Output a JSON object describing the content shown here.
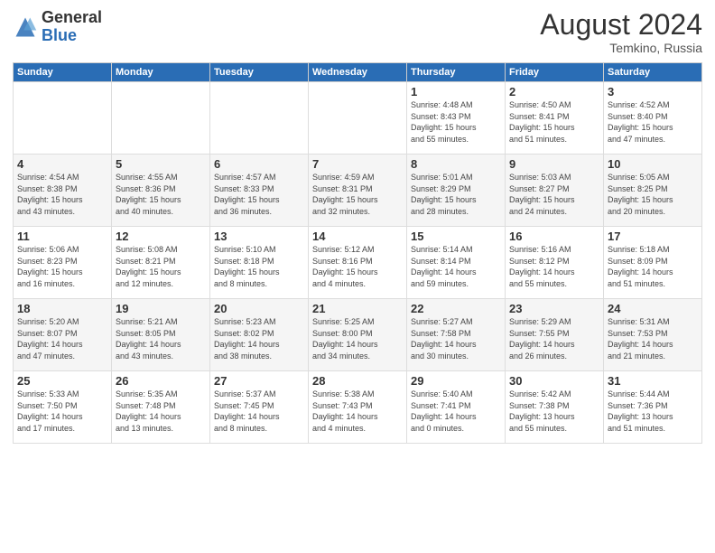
{
  "logo": {
    "general": "General",
    "blue": "Blue"
  },
  "title": {
    "month_year": "August 2024",
    "location": "Temkino, Russia"
  },
  "headers": [
    "Sunday",
    "Monday",
    "Tuesday",
    "Wednesday",
    "Thursday",
    "Friday",
    "Saturday"
  ],
  "weeks": [
    [
      {
        "day": "",
        "info": ""
      },
      {
        "day": "",
        "info": ""
      },
      {
        "day": "",
        "info": ""
      },
      {
        "day": "",
        "info": ""
      },
      {
        "day": "1",
        "info": "Sunrise: 4:48 AM\nSunset: 8:43 PM\nDaylight: 15 hours\nand 55 minutes."
      },
      {
        "day": "2",
        "info": "Sunrise: 4:50 AM\nSunset: 8:41 PM\nDaylight: 15 hours\nand 51 minutes."
      },
      {
        "day": "3",
        "info": "Sunrise: 4:52 AM\nSunset: 8:40 PM\nDaylight: 15 hours\nand 47 minutes."
      }
    ],
    [
      {
        "day": "4",
        "info": "Sunrise: 4:54 AM\nSunset: 8:38 PM\nDaylight: 15 hours\nand 43 minutes."
      },
      {
        "day": "5",
        "info": "Sunrise: 4:55 AM\nSunset: 8:36 PM\nDaylight: 15 hours\nand 40 minutes."
      },
      {
        "day": "6",
        "info": "Sunrise: 4:57 AM\nSunset: 8:33 PM\nDaylight: 15 hours\nand 36 minutes."
      },
      {
        "day": "7",
        "info": "Sunrise: 4:59 AM\nSunset: 8:31 PM\nDaylight: 15 hours\nand 32 minutes."
      },
      {
        "day": "8",
        "info": "Sunrise: 5:01 AM\nSunset: 8:29 PM\nDaylight: 15 hours\nand 28 minutes."
      },
      {
        "day": "9",
        "info": "Sunrise: 5:03 AM\nSunset: 8:27 PM\nDaylight: 15 hours\nand 24 minutes."
      },
      {
        "day": "10",
        "info": "Sunrise: 5:05 AM\nSunset: 8:25 PM\nDaylight: 15 hours\nand 20 minutes."
      }
    ],
    [
      {
        "day": "11",
        "info": "Sunrise: 5:06 AM\nSunset: 8:23 PM\nDaylight: 15 hours\nand 16 minutes."
      },
      {
        "day": "12",
        "info": "Sunrise: 5:08 AM\nSunset: 8:21 PM\nDaylight: 15 hours\nand 12 minutes."
      },
      {
        "day": "13",
        "info": "Sunrise: 5:10 AM\nSunset: 8:18 PM\nDaylight: 15 hours\nand 8 minutes."
      },
      {
        "day": "14",
        "info": "Sunrise: 5:12 AM\nSunset: 8:16 PM\nDaylight: 15 hours\nand 4 minutes."
      },
      {
        "day": "15",
        "info": "Sunrise: 5:14 AM\nSunset: 8:14 PM\nDaylight: 14 hours\nand 59 minutes."
      },
      {
        "day": "16",
        "info": "Sunrise: 5:16 AM\nSunset: 8:12 PM\nDaylight: 14 hours\nand 55 minutes."
      },
      {
        "day": "17",
        "info": "Sunrise: 5:18 AM\nSunset: 8:09 PM\nDaylight: 14 hours\nand 51 minutes."
      }
    ],
    [
      {
        "day": "18",
        "info": "Sunrise: 5:20 AM\nSunset: 8:07 PM\nDaylight: 14 hours\nand 47 minutes."
      },
      {
        "day": "19",
        "info": "Sunrise: 5:21 AM\nSunset: 8:05 PM\nDaylight: 14 hours\nand 43 minutes."
      },
      {
        "day": "20",
        "info": "Sunrise: 5:23 AM\nSunset: 8:02 PM\nDaylight: 14 hours\nand 38 minutes."
      },
      {
        "day": "21",
        "info": "Sunrise: 5:25 AM\nSunset: 8:00 PM\nDaylight: 14 hours\nand 34 minutes."
      },
      {
        "day": "22",
        "info": "Sunrise: 5:27 AM\nSunset: 7:58 PM\nDaylight: 14 hours\nand 30 minutes."
      },
      {
        "day": "23",
        "info": "Sunrise: 5:29 AM\nSunset: 7:55 PM\nDaylight: 14 hours\nand 26 minutes."
      },
      {
        "day": "24",
        "info": "Sunrise: 5:31 AM\nSunset: 7:53 PM\nDaylight: 14 hours\nand 21 minutes."
      }
    ],
    [
      {
        "day": "25",
        "info": "Sunrise: 5:33 AM\nSunset: 7:50 PM\nDaylight: 14 hours\nand 17 minutes."
      },
      {
        "day": "26",
        "info": "Sunrise: 5:35 AM\nSunset: 7:48 PM\nDaylight: 14 hours\nand 13 minutes."
      },
      {
        "day": "27",
        "info": "Sunrise: 5:37 AM\nSunset: 7:45 PM\nDaylight: 14 hours\nand 8 minutes."
      },
      {
        "day": "28",
        "info": "Sunrise: 5:38 AM\nSunset: 7:43 PM\nDaylight: 14 hours\nand 4 minutes."
      },
      {
        "day": "29",
        "info": "Sunrise: 5:40 AM\nSunset: 7:41 PM\nDaylight: 14 hours\nand 0 minutes."
      },
      {
        "day": "30",
        "info": "Sunrise: 5:42 AM\nSunset: 7:38 PM\nDaylight: 13 hours\nand 55 minutes."
      },
      {
        "day": "31",
        "info": "Sunrise: 5:44 AM\nSunset: 7:36 PM\nDaylight: 13 hours\nand 51 minutes."
      }
    ]
  ]
}
